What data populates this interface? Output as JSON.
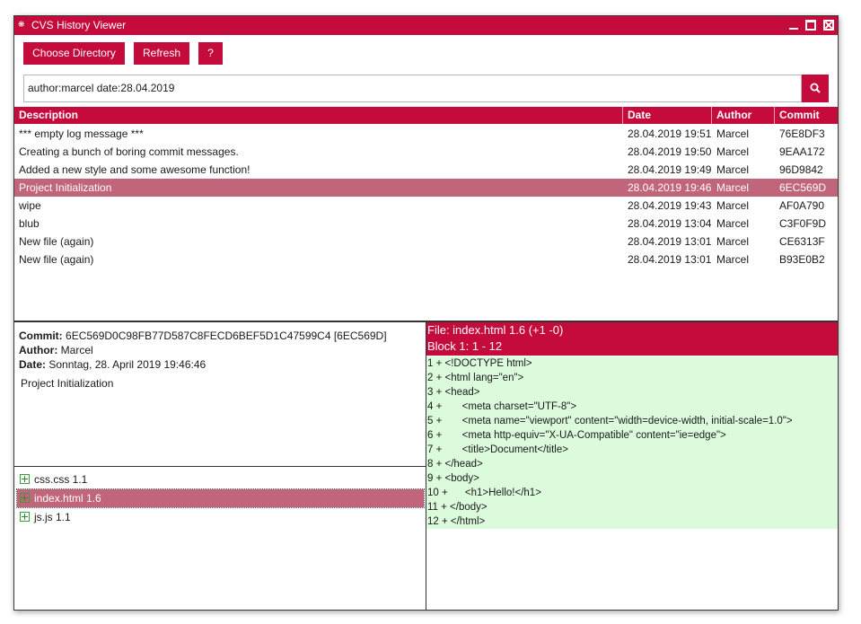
{
  "window": {
    "title": "CVS History Viewer"
  },
  "toolbar": {
    "choose_label": "Choose Directory",
    "refresh_label": "Refresh",
    "help_label": "?"
  },
  "search": {
    "value": "author:marcel date:28.04.2019"
  },
  "table": {
    "headers": {
      "description": "Description",
      "date": "Date",
      "author": "Author",
      "commit": "Commit"
    },
    "rows": [
      {
        "description": "*** empty log message ***",
        "date": "28.04.2019 19:51",
        "author": "Marcel",
        "commit": "76E8DF3"
      },
      {
        "description": "Creating a bunch of boring commit messages.",
        "date": "28.04.2019 19:50",
        "author": "Marcel",
        "commit": "9EAA172"
      },
      {
        "description": "Added a new style and some awesome function!",
        "date": "28.04.2019 19:49",
        "author": "Marcel",
        "commit": "96D9842"
      },
      {
        "description": "Project Initialization",
        "date": "28.04.2019 19:46",
        "author": "Marcel",
        "commit": "6EC569D"
      },
      {
        "description": "wipe",
        "date": "28.04.2019 19:43",
        "author": "Marcel",
        "commit": "AF0A790"
      },
      {
        "description": "blub",
        "date": "28.04.2019 13:04",
        "author": "Marcel",
        "commit": "C3F0F9D"
      },
      {
        "description": "New file (again)",
        "date": "28.04.2019 13:01",
        "author": "Marcel",
        "commit": "CE6313F"
      },
      {
        "description": "New file (again)",
        "date": "28.04.2019 13:01",
        "author": "Marcel",
        "commit": "B93E0B2"
      }
    ]
  },
  "details": {
    "commit_label": "Commit:",
    "commit_value": "6EC569D0C98FB77D587C8FECD6BEF5D1C47599C4 [6EC569D]",
    "author_label": "Author:",
    "author_value": "Marcel",
    "date_label": "Date:",
    "date_value": "Sonntag, 28. April 2019 19:46:46",
    "message": "Project Initialization"
  },
  "files": [
    {
      "name": "css.css 1.1"
    },
    {
      "name": "index.html 1.6"
    },
    {
      "name": "js.js 1.1"
    }
  ],
  "diff": {
    "file_title": "File: index.html 1.6 (+1 -0)",
    "block_title": "Block 1: 1 - 12",
    "lines": [
      "1 + <!DOCTYPE html>",
      "2 + <html lang=\"en\">",
      "3 + <head>",
      "4 +       <meta charset=\"UTF-8\">",
      "5 +       <meta name=\"viewport\" content=\"width=device-width, initial-scale=1.0\">",
      "6 +       <meta http-equiv=\"X-UA-Compatible\" content=\"ie=edge\">",
      "7 +       <title>Document</title>",
      "8 + </head>",
      "9 + <body>",
      "10 +      <h1>Hello!</h1>",
      "11 + </body>",
      "12 + </html>"
    ]
  },
  "colors": {
    "accent": "#c50a3c",
    "selected_row": "#c1657a",
    "diff_added": "#dcfadc"
  }
}
